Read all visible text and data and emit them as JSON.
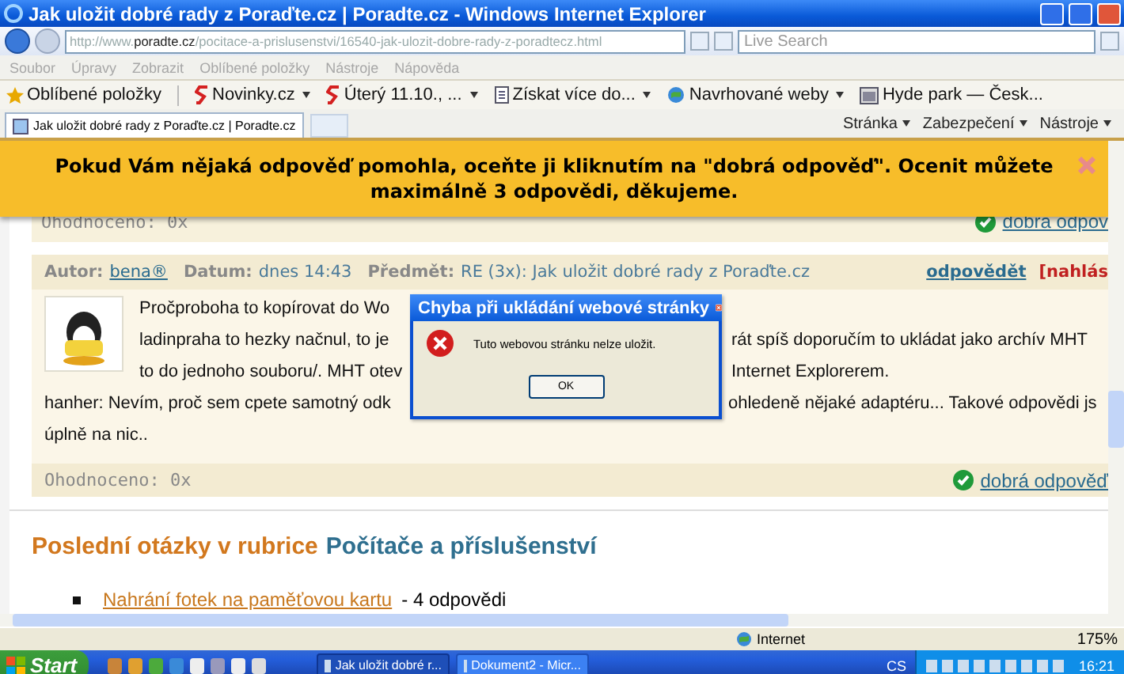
{
  "window": {
    "title": "Jak uložit dobré rady z Poraďte.cz | Poradte.cz - Windows Internet Explorer"
  },
  "address_bar": {
    "url_parts": [
      {
        "text": "http://www.",
        "kind": "dim"
      },
      {
        "text": "poradte.cz",
        "kind": "host"
      },
      {
        "text": "/pocitace-a-prislusenstvi/16540-jak-ulozit-dobre-rady-z-poradtecz.html",
        "kind": "dim"
      }
    ],
    "search_placeholder": "Live Search"
  },
  "menu": [
    "Soubor",
    "Úpravy",
    "Zobrazit",
    "Oblíbené položky",
    "Nástroje",
    "Nápověda"
  ],
  "favorites_bar": {
    "label": "Oblíbené položky",
    "links": [
      {
        "label": "Novinky.cz",
        "kind": "s-logo",
        "dropdown": true
      },
      {
        "label": "Úterý 11.10., ...",
        "kind": "s-logo",
        "dropdown": true
      },
      {
        "label": "Získat více do...",
        "kind": "page",
        "dropdown": true
      },
      {
        "label": "Navrhované weby",
        "kind": "globe",
        "dropdown": true
      },
      {
        "label": "Hyde park — Česk...",
        "kind": "window",
        "dropdown": false
      }
    ]
  },
  "tab": {
    "label": "Jak uložit dobré rady z Poraďte.cz | Poradte.cz"
  },
  "command_bar": [
    "Stránka",
    "Zabezpečení",
    "Nástroje"
  ],
  "banner": {
    "text": "Pokud Vám nějaká odpověď pomohla, oceňte ji kliknutím na \"dobrá odpověď\". Ocenit můžete maximálně 3 odpovědi, děkujeme."
  },
  "previous_post_footer": {
    "rating": "Ohodnoceno: 0x",
    "good_answer": "dobrá odpov"
  },
  "post": {
    "author_label": "Autor:",
    "author": "bena®",
    "date_label": "Datum:",
    "date": "dnes 14:43",
    "subject_label": "Předmět:",
    "subject": "RE (3x): Jak uložit dobré rady z Poraďte.cz",
    "reply": "odpovědět",
    "report": "[nahlás",
    "paragraphs": [
      {
        "kind": "avatar",
        "lines": [
          {
            "left": "Pročproboha to kopírovat do Wo"
          },
          {
            "left": "ladinpraha to hezky načnul, to je",
            "right": "rát spíš doporučím to ukládat jako archív MHT"
          },
          {
            "left": "to do jednoho souboru/. MHT otev",
            "right": "Internet Explorerem."
          }
        ]
      },
      {
        "kind": "plain",
        "lines": [
          {
            "left": "hanher: Nevím, proč sem cpete samotný odk",
            "right": "ohledeně nějaké adaptéru... Takové odpovědi js"
          },
          {
            "left": "úplně na nic.."
          }
        ]
      }
    ],
    "rating": "Ohodnoceno: 0x",
    "good_answer": "dobrá odpověď"
  },
  "section": {
    "title": "Poslední otázky v rubrice",
    "category": "Počítače a příslušenství",
    "items": [
      {
        "link": "Nahrání fotek na paměťovou kartu",
        "count": "- 4 odpovědi"
      }
    ]
  },
  "dialog": {
    "title": "Chyba při ukládání webové stránky",
    "message": "Tuto webovou stránku nelze uložit.",
    "button": "OK"
  },
  "status_bar": {
    "zone": "Internet",
    "zoom": "175%"
  },
  "taskbar": {
    "start": "Start",
    "tasks": [
      {
        "label": "Jak uložit dobré r...",
        "selected": true
      },
      {
        "label": "Dokument2 - Micr...",
        "selected": false
      }
    ],
    "language": "CS",
    "clock": "16:21"
  }
}
